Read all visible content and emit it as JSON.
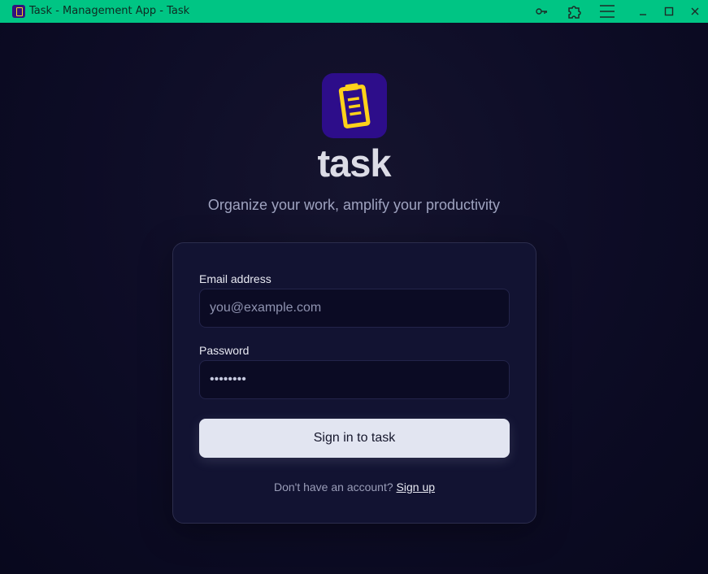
{
  "window": {
    "title": "Task - Management App - Task",
    "titlebar_color": "#00c584",
    "buttons": [
      "key-icon",
      "puzzle-icon",
      "menu-icon",
      "minimize-icon",
      "maximize-icon",
      "close-icon"
    ]
  },
  "brand": {
    "name": "task",
    "tagline": "Organize your work, amplify your productivity",
    "logo_bg": "#2d0d8a",
    "logo_color": "#ffd21a"
  },
  "form": {
    "email_label": "Email address",
    "email_placeholder": "you@example.com",
    "email_value": "",
    "password_label": "Password",
    "password_value": "••••••••",
    "submit_label": "Sign in to task",
    "signup_prompt": "Don't have an account?",
    "signup_link": "Sign up"
  }
}
